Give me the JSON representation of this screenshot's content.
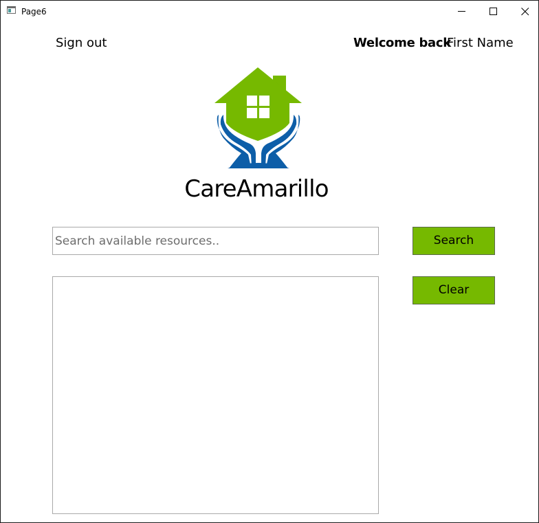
{
  "window": {
    "title": "Page6"
  },
  "header": {
    "sign_out": "Sign out",
    "welcome": "Welcome back",
    "user_name": "First Name"
  },
  "brand": {
    "name": "CareAmarillo",
    "logo_icon": "house-in-hands-logo",
    "colors": {
      "green": "#76b900",
      "blue": "#0d5ea8"
    }
  },
  "search": {
    "placeholder": "Search available resources..",
    "value": "",
    "search_label": "Search",
    "clear_label": "Clear"
  },
  "results": {
    "items": []
  },
  "colors": {
    "button_bg": "#76b900",
    "input_border": "#a9a9a9"
  }
}
